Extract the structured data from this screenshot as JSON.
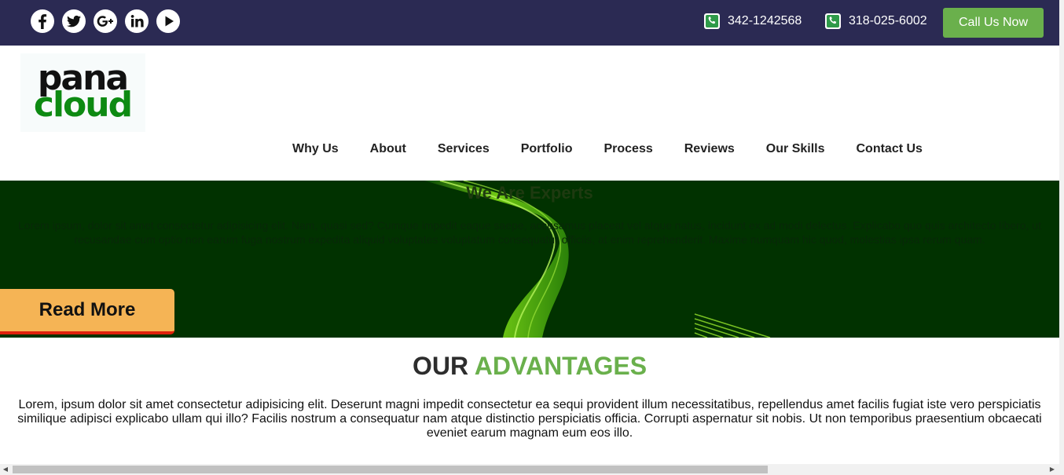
{
  "topbar": {
    "social": [
      {
        "name": "facebook-icon",
        "glyph": "f"
      },
      {
        "name": "twitter-icon",
        "glyph": "t"
      },
      {
        "name": "google-plus-icon",
        "glyph": "G+"
      },
      {
        "name": "linkedin-icon",
        "glyph": "in"
      },
      {
        "name": "youtube-icon",
        "glyph": "play"
      }
    ],
    "phone1": "342-1242568",
    "phone2": "318-025-6002",
    "call_button": "Call Us Now",
    "colors": {
      "bar": "#2b2a53",
      "button": "#6ab04c",
      "phone_icon": "#2e9a49"
    }
  },
  "logo": {
    "line1": "pana",
    "line2": "cloud",
    "colors": {
      "top": "#111111",
      "bottom": "#0d8a12"
    }
  },
  "nav": {
    "items": [
      "Why Us",
      "About",
      "Services",
      "Portfolio",
      "Process",
      "Reviews",
      "Our Skills",
      "Contact Us"
    ]
  },
  "hero": {
    "title": "We Are Experts",
    "text": "Lorem ipsum, dolor sit amet consectetur adipisicing elit. Nam, quasi sed? Cumque impedit eaque saepe, accusamus placeat vel atque natus, incidunt ex ad modi delectus. Explicabo quo quis architecto libero, ut recusandae cum optio non earum fuga nostrum expedita aliquid voluptates voluptatum consequatur officiis, at enim reprehenderit. Maxime numquam hic quod, molestias ipsa rerum quam.",
    "button": "Read More",
    "colors": {
      "background": "#013200",
      "wave": "#7cd916",
      "button": "#f5b455",
      "button_border": "#e0210c"
    }
  },
  "advantages": {
    "title_part1": "OUR",
    "title_part2": "ADVANTAGES",
    "text": "Lorem, ipsum dolor sit amet consectetur adipisicing elit. Deserunt magni impedit consectetur ea sequi provident illum necessitatibus, repellendus amet facilis fugiat iste vero perspiciatis similique adipisci explicabo ullam qui illo? Facilis nostrum a consequatur nam atque distinctio perspiciatis officia. Corrupti aspernatur sit nobis. Ut non temporibus praesentium obcaecati eveniet earum magnam eum eos illo."
  }
}
